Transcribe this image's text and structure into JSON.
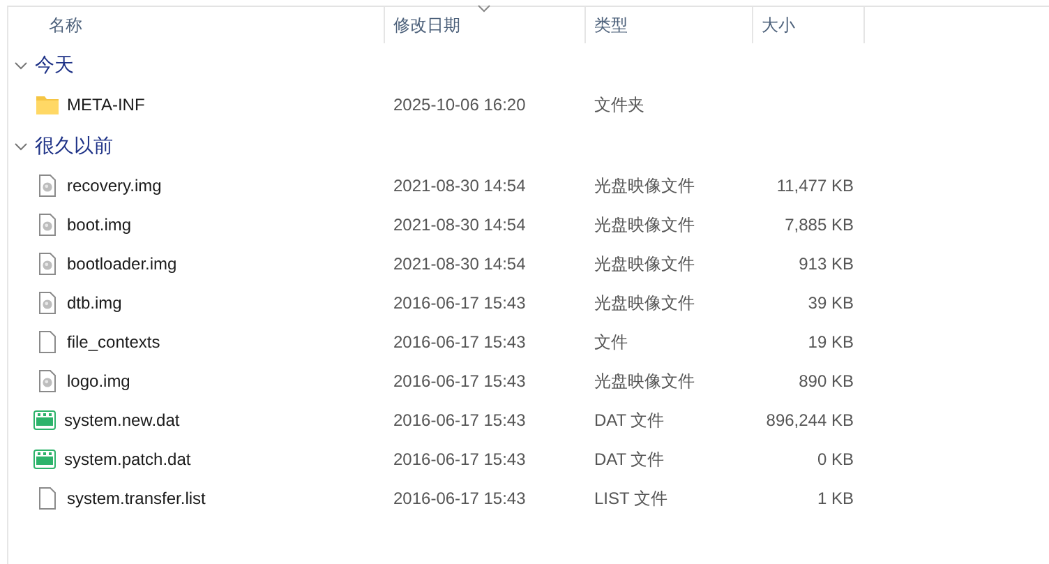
{
  "columns": [
    {
      "label": "名称",
      "sorted": false
    },
    {
      "label": "修改日期",
      "sorted": true
    },
    {
      "label": "类型",
      "sorted": false
    },
    {
      "label": "大小",
      "sorted": false
    }
  ],
  "groups": [
    {
      "label": "今天",
      "expanded": true,
      "rows": [
        {
          "kind": "folder",
          "name": "META-INF",
          "date": "2025-10-06 16:20",
          "type": "文件夹",
          "size": ""
        }
      ]
    },
    {
      "label": "很久以前",
      "expanded": true,
      "rows": [
        {
          "kind": "disc",
          "name": "recovery.img",
          "date": "2021-08-30 14:54",
          "type": "光盘映像文件",
          "size": "11,477 KB"
        },
        {
          "kind": "disc",
          "name": "boot.img",
          "date": "2021-08-30 14:54",
          "type": "光盘映像文件",
          "size": "7,885 KB"
        },
        {
          "kind": "disc",
          "name": "bootloader.img",
          "date": "2021-08-30 14:54",
          "type": "光盘映像文件",
          "size": "913 KB"
        },
        {
          "kind": "disc",
          "name": "dtb.img",
          "date": "2016-06-17 15:43",
          "type": "光盘映像文件",
          "size": "39 KB"
        },
        {
          "kind": "file",
          "name": "file_contexts",
          "date": "2016-06-17 15:43",
          "type": "文件",
          "size": "19 KB"
        },
        {
          "kind": "disc",
          "name": "logo.img",
          "date": "2016-06-17 15:43",
          "type": "光盘映像文件",
          "size": "890 KB"
        },
        {
          "kind": "vcd",
          "name": "system.new.dat",
          "date": "2016-06-17 15:43",
          "type": "DAT 文件",
          "size": "896,244 KB"
        },
        {
          "kind": "vcd",
          "name": "system.patch.dat",
          "date": "2016-06-17 15:43",
          "type": "DAT 文件",
          "size": "0 KB"
        },
        {
          "kind": "file",
          "name": "system.transfer.list",
          "date": "2016-06-17 15:43",
          "type": "LIST 文件",
          "size": "1 KB"
        }
      ]
    }
  ]
}
